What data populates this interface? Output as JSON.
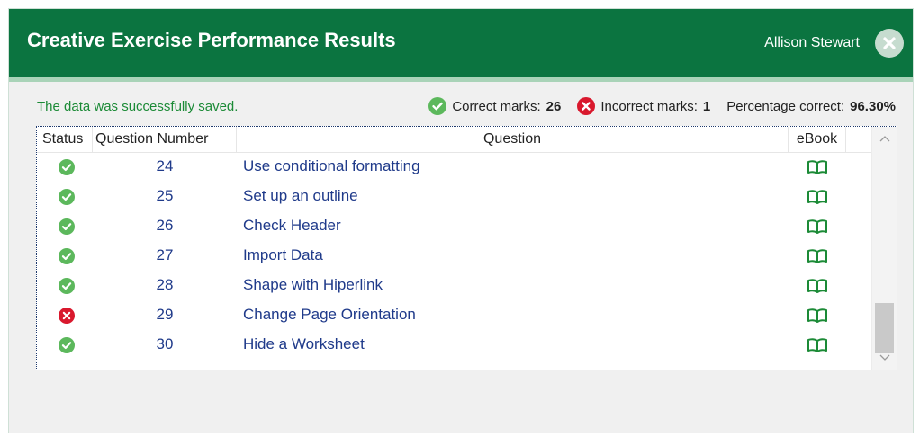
{
  "window": {
    "title": "Creative Exercise Performance Results",
    "user_name": "Allison Stewart",
    "accent_color": "#0b7440"
  },
  "status": {
    "message": "The data was successfully saved."
  },
  "summary": {
    "correct_label": "Correct marks:",
    "correct_value": "26",
    "incorrect_label": "Incorrect marks:",
    "incorrect_value": "1",
    "percentage_label": "Percentage correct:",
    "percentage_value": "96.30%"
  },
  "table": {
    "columns": [
      "Status",
      "Question Number",
      "Question",
      "eBook"
    ],
    "rows": [
      {
        "status": "correct",
        "number": "24",
        "question": "Use conditional formatting",
        "ebook_icon": "book-icon"
      },
      {
        "status": "correct",
        "number": "25",
        "question": "Set up an outline",
        "ebook_icon": "book-icon"
      },
      {
        "status": "correct",
        "number": "26",
        "question": "Check Header",
        "ebook_icon": "book-icon"
      },
      {
        "status": "correct",
        "number": "27",
        "question": "Import Data",
        "ebook_icon": "book-icon"
      },
      {
        "status": "correct",
        "number": "28",
        "question": "Shape with Hiperlink",
        "ebook_icon": "book-icon"
      },
      {
        "status": "incorrect",
        "number": "29",
        "question": "Change Page Orientation",
        "ebook_icon": "book-icon"
      },
      {
        "status": "correct",
        "number": "30",
        "question": "Hide a Worksheet",
        "ebook_icon": "book-icon"
      }
    ]
  },
  "colors": {
    "correct": "#5cb85c",
    "incorrect": "#d9182d",
    "link": "#1f3a8a"
  }
}
